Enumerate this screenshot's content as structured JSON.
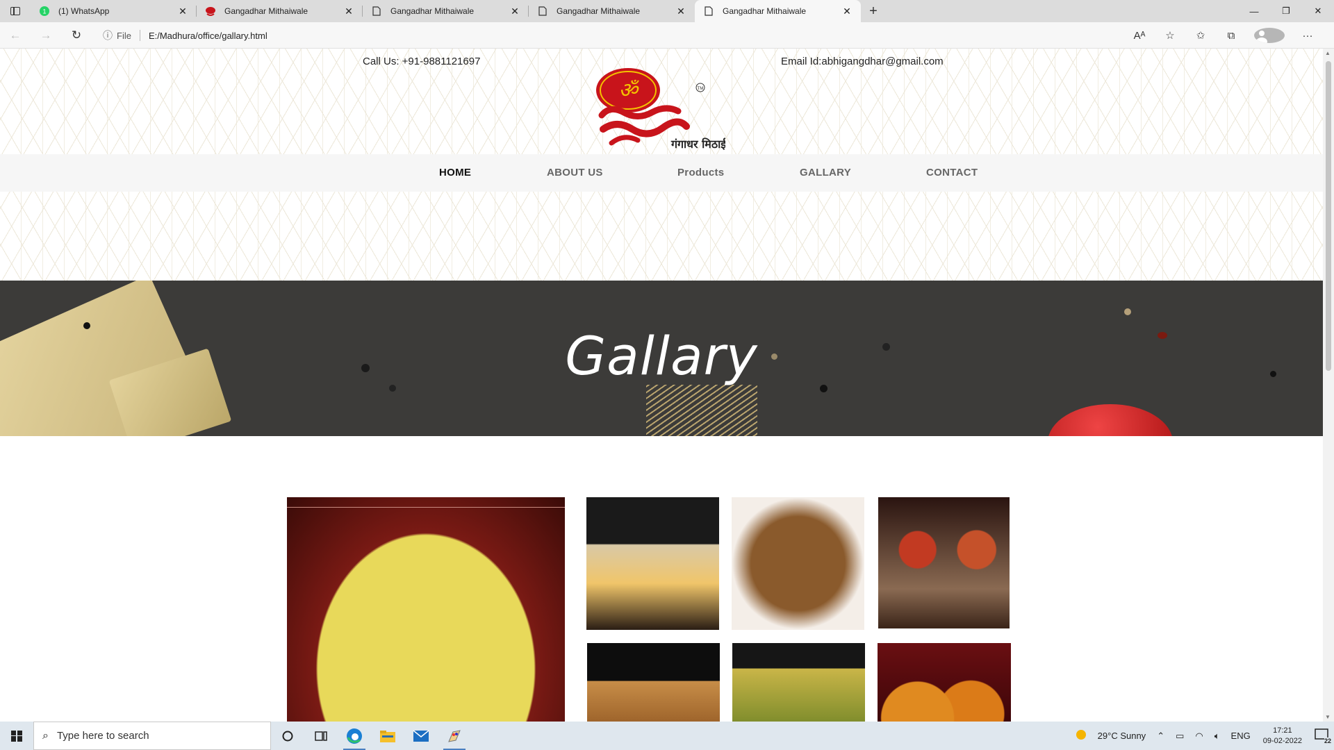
{
  "browser": {
    "tabs": [
      {
        "title": "(1) WhatsApp",
        "icon": "whatsapp-icon"
      },
      {
        "title": "Gangadhar Mithaiwale",
        "icon": "logo-favicon-icon"
      },
      {
        "title": "Gangadhar Mithaiwale",
        "icon": "page-icon"
      },
      {
        "title": "Gangadhar Mithaiwale",
        "icon": "page-icon"
      },
      {
        "title": "Gangadhar Mithaiwale",
        "icon": "page-icon"
      }
    ],
    "active_tab": 4,
    "address": {
      "scheme": "File",
      "url": "E:/Madhura/office/gallary.html"
    }
  },
  "site": {
    "call": "Call Us: +91-9881121697",
    "email": "Email Id:abhigangdhar@gmail.com",
    "logo_text": "गंगाधर मिठाईवाले",
    "nav": [
      "HOME",
      "ABOUT US",
      "Products",
      "GALLARY",
      "CONTACT"
    ],
    "hero_title": "Gallary"
  },
  "gallery": [
    {
      "name": "rasmalai-bowl",
      "color": "#d9c442"
    },
    {
      "name": "kulfi-cups",
      "color": "#7a6a4c"
    },
    {
      "name": "bhakarwadi",
      "color": "#8a5a2c"
    },
    {
      "name": "gulab-jamun",
      "color": "#5a2a1a"
    },
    {
      "name": "samosa",
      "color": "#b07a3a"
    },
    {
      "name": "dhokla",
      "color": "#b8a23a"
    },
    {
      "name": "motichoor-laddu",
      "color": "#d77a1e"
    }
  ],
  "taskbar": {
    "search_placeholder": "Type here to search",
    "weather": "29°C  Sunny",
    "lang": "ENG",
    "time": "17:21",
    "date": "09-02-2022",
    "notifications": "22"
  },
  "colors": {
    "accent": "#e7222a",
    "brand_red": "#c8141b"
  }
}
